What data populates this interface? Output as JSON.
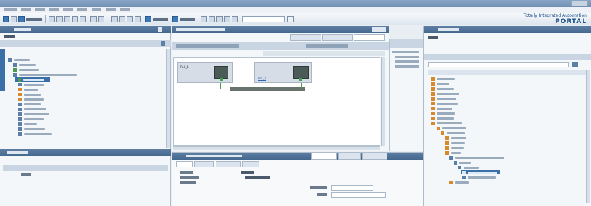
{
  "app": {
    "brand_line1": "Totally Integrated Automation",
    "brand_line2": "PORTAL"
  },
  "canvas": {
    "device1": {
      "name": "PLC_1",
      "link": "PLC_1"
    },
    "device2": {
      "link": "PLC_1"
    },
    "network_label": "PLC_1.PROFINET"
  },
  "colors": {
    "panel_header": "#45688f",
    "selection": "#3b6fa8",
    "module": "#4b5b57",
    "link": "#2b66c2",
    "brand": "#1d4f8a"
  }
}
